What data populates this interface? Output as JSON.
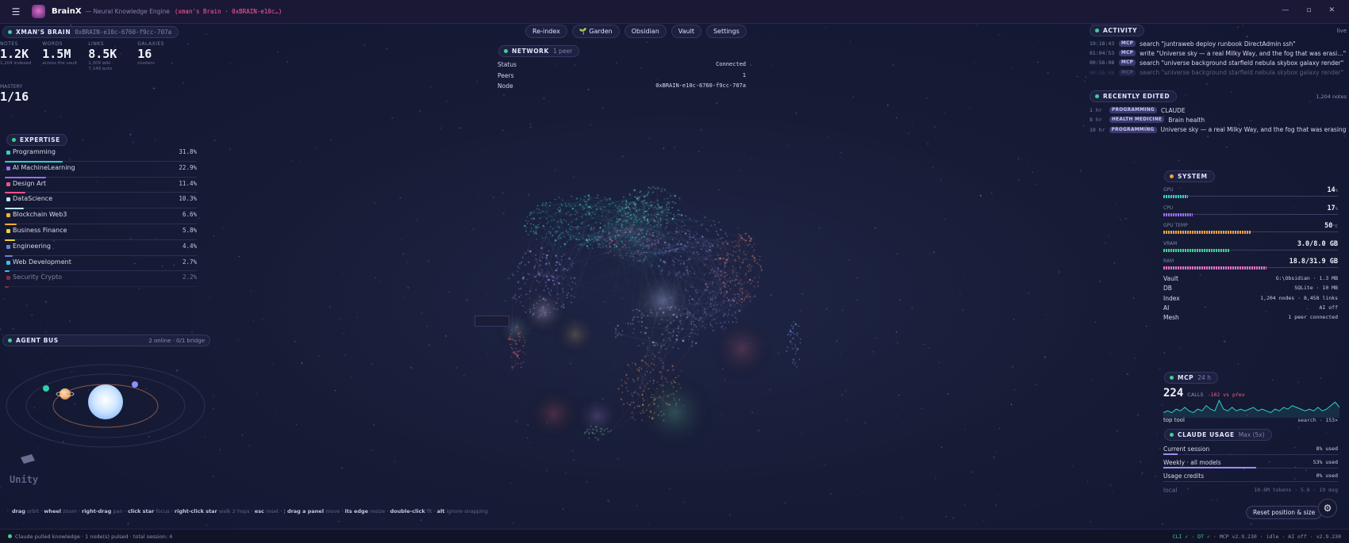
{
  "window": {
    "app_name": "BrainX",
    "subtitle": "— Neural Knowledge Engine",
    "brain_id": "(xman's Brain · 0xBRAIN-e10c…)",
    "controls": [
      "—",
      "▫",
      "✕"
    ]
  },
  "brain": {
    "title": "XMAN'S BRAIN",
    "id": "0xBRAIN-e10c-6760-f9cc-707a",
    "stats": [
      {
        "label": "NOTES",
        "value": "1.2K",
        "sub": "1,204 indexed"
      },
      {
        "label": "WORDS",
        "value": "1.5M",
        "sub": "across the vault"
      },
      {
        "label": "LINKS",
        "value": "8.5K",
        "sub": "1,309 wiki · 7,149 auto"
      },
      {
        "label": "GALAXIES",
        "value": "16",
        "sub": "clusters"
      }
    ],
    "mastery_label": "MASTERY",
    "mastery_value": "1/16"
  },
  "expertise": {
    "title": "EXPERTISE",
    "items": [
      {
        "name": "Programming",
        "pct": "31.8%",
        "value": 31.8,
        "color": "#2fd0c8"
      },
      {
        "name": "AI MachineLearning",
        "pct": "22.9%",
        "value": 22.9,
        "color": "#9b6cf0"
      },
      {
        "name": "Design Art",
        "pct": "11.4%",
        "value": 11.4,
        "color": "#f0508a"
      },
      {
        "name": "DataScience",
        "pct": "10.3%",
        "value": 10.3,
        "color": "#b8e8f0"
      },
      {
        "name": "Blockchain Web3",
        "pct": "6.6%",
        "value": 6.6,
        "color": "#f0b030"
      },
      {
        "name": "Business Finance",
        "pct": "5.8%",
        "value": 5.8,
        "color": "#f0d040"
      },
      {
        "name": "Engineering",
        "pct": "4.4%",
        "value": 4.4,
        "color": "#7080d0"
      },
      {
        "name": "Web Development",
        "pct": "2.7%",
        "value": 2.7,
        "color": "#40c0e0"
      },
      {
        "name": "Security Crypto",
        "pct": "2.2%",
        "value": 2.2,
        "color": "#e04050"
      }
    ]
  },
  "agent_bus": {
    "title": "AGENT BUS",
    "meta": "2 online · 0/1 bridge",
    "center_label": "Unity"
  },
  "hints": [
    {
      "key": "drag",
      "desc": "orbit"
    },
    {
      "key": "wheel",
      "desc": "zoom"
    },
    {
      "key": "right-drag",
      "desc": "pan"
    },
    {
      "key": "click star",
      "desc": "focus"
    },
    {
      "key": "right-click star",
      "desc": "walk 2 hops"
    },
    {
      "key": "esc",
      "desc": "reset"
    },
    {
      "key": "drag a panel",
      "desc": "move"
    },
    {
      "key": "its edge",
      "desc": "resize"
    },
    {
      "key": "double-click",
      "desc": "fit"
    },
    {
      "key": "alt",
      "desc": "ignore snapping"
    }
  ],
  "toolbar": [
    "Re-index",
    "🌱 Garden",
    "Obsidian",
    "Vault",
    "Settings"
  ],
  "network": {
    "title": "NETWORK",
    "peers_badge": "1 peer",
    "rows": [
      {
        "label": "Status",
        "value": "Connected"
      },
      {
        "label": "Peers",
        "value": "1"
      },
      {
        "label": "Node",
        "value": "0xBRAIN-e10c-6760-f9cc-707a"
      }
    ]
  },
  "activity": {
    "title": "ACTIVITY",
    "live": "live",
    "rows": [
      {
        "time": "19:18:43",
        "tag": "MCP",
        "text": "search \"juntraweb deploy runbook DirectAdmin ssh\""
      },
      {
        "time": "01:04:53",
        "tag": "MCP",
        "text": "write \"Universe sky — a real Milky Way, and the fog that was erasi…\""
      },
      {
        "time": "00:56:08",
        "tag": "MCP",
        "text": "search \"universe background starfield nebula skybox galaxy render\""
      },
      {
        "time": "00:56:08",
        "tag": "MCP",
        "text": "search \"universe background starfield nebula skybox galaxy render\""
      },
      {
        "time": "00:56:08",
        "tag": "MCP",
        "text": "search \"universe background starfield nebula skybox galaxy render\""
      }
    ]
  },
  "recently_edited": {
    "title": "RECENTLY EDITED",
    "count": "1,204 notes",
    "rows": [
      {
        "time": "1 hr",
        "tag": "PROGRAMMING",
        "text": "CLAUDE"
      },
      {
        "time": "8 hr",
        "tag": "HEALTH MEDICINE",
        "text": "Brain health"
      },
      {
        "time": "10 hr",
        "tag": "PROGRAMMING",
        "text": "Universe sky — a real Milky Way, and the fog that was erasing the old starfi…"
      }
    ]
  },
  "system": {
    "title": "SYSTEM",
    "metrics": [
      {
        "label": "GPU",
        "value": "14",
        "unit": "%",
        "fraction": 0.14,
        "color": "#2fd0c8"
      },
      {
        "label": "CPU",
        "value": "17",
        "unit": "%",
        "fraction": 0.17,
        "color": "#9b6cf0"
      },
      {
        "label": "GPU TEMP",
        "value": "50",
        "unit": "°C",
        "fraction": 0.5,
        "color": "#f0a040"
      },
      {
        "label": "VRAM",
        "value": "3.0/8.0 GB",
        "unit": "",
        "fraction": 0.375,
        "color": "#3fd08f"
      },
      {
        "label": "RAM",
        "value": "18.8/31.9 GB",
        "unit": "",
        "fraction": 0.59,
        "color": "#e070c8"
      }
    ],
    "info": [
      {
        "label": "Vault",
        "value": "G:\\Obsidian · 1.3 MB"
      },
      {
        "label": "DB",
        "value": "SQLite · 10 MB"
      },
      {
        "label": "Index",
        "value": "1,204 nodes · 8,458 links"
      },
      {
        "label": "AI",
        "value": "AI off"
      },
      {
        "label": "Mesh",
        "value": "1 peer connected"
      }
    ]
  },
  "mcp": {
    "title": "MCP",
    "period": "24 h",
    "calls": "224",
    "calls_label": "CALLS",
    "delta": "-102 vs prev",
    "top_tool_label": "top tool",
    "top_tool_value": "search · 153×",
    "spark": [
      2,
      3,
      2,
      4,
      3,
      5,
      3,
      2,
      4,
      3,
      6,
      4,
      3,
      9,
      4,
      3,
      5,
      3,
      4,
      3,
      4,
      5,
      3,
      4,
      3,
      2,
      4,
      3,
      5,
      4,
      6,
      5,
      4,
      3,
      4,
      3,
      5,
      3,
      4,
      6,
      8,
      5
    ]
  },
  "claude_usage": {
    "title": "CLAUDE USAGE",
    "plan": "Max (5x)",
    "rows": [
      {
        "label": "Current session",
        "value": "8% used",
        "fraction": 0.08
      },
      {
        "label": "Weekly · all models",
        "value": "53% used",
        "fraction": 0.53
      },
      {
        "label": "Usage credits",
        "value": "0% used",
        "fraction": 0.0
      },
      {
        "label": "local",
        "value": "10.6M tokens · 5.6 · 19 msg",
        "fraction": null
      }
    ]
  },
  "buttons": {
    "reset": "Reset position & size"
  },
  "status": {
    "left": "Claude pulled knowledge · 1 node(s) pulsed · total session: 4",
    "right": [
      "CLI ✓",
      "DT ✓",
      "MCP v2.9.230",
      "idle",
      "AI off",
      "v2.9.230"
    ]
  },
  "colors": {
    "accent": "#3fd08f",
    "brand_pink": "#ff5b9c",
    "background": "#171c36"
  }
}
